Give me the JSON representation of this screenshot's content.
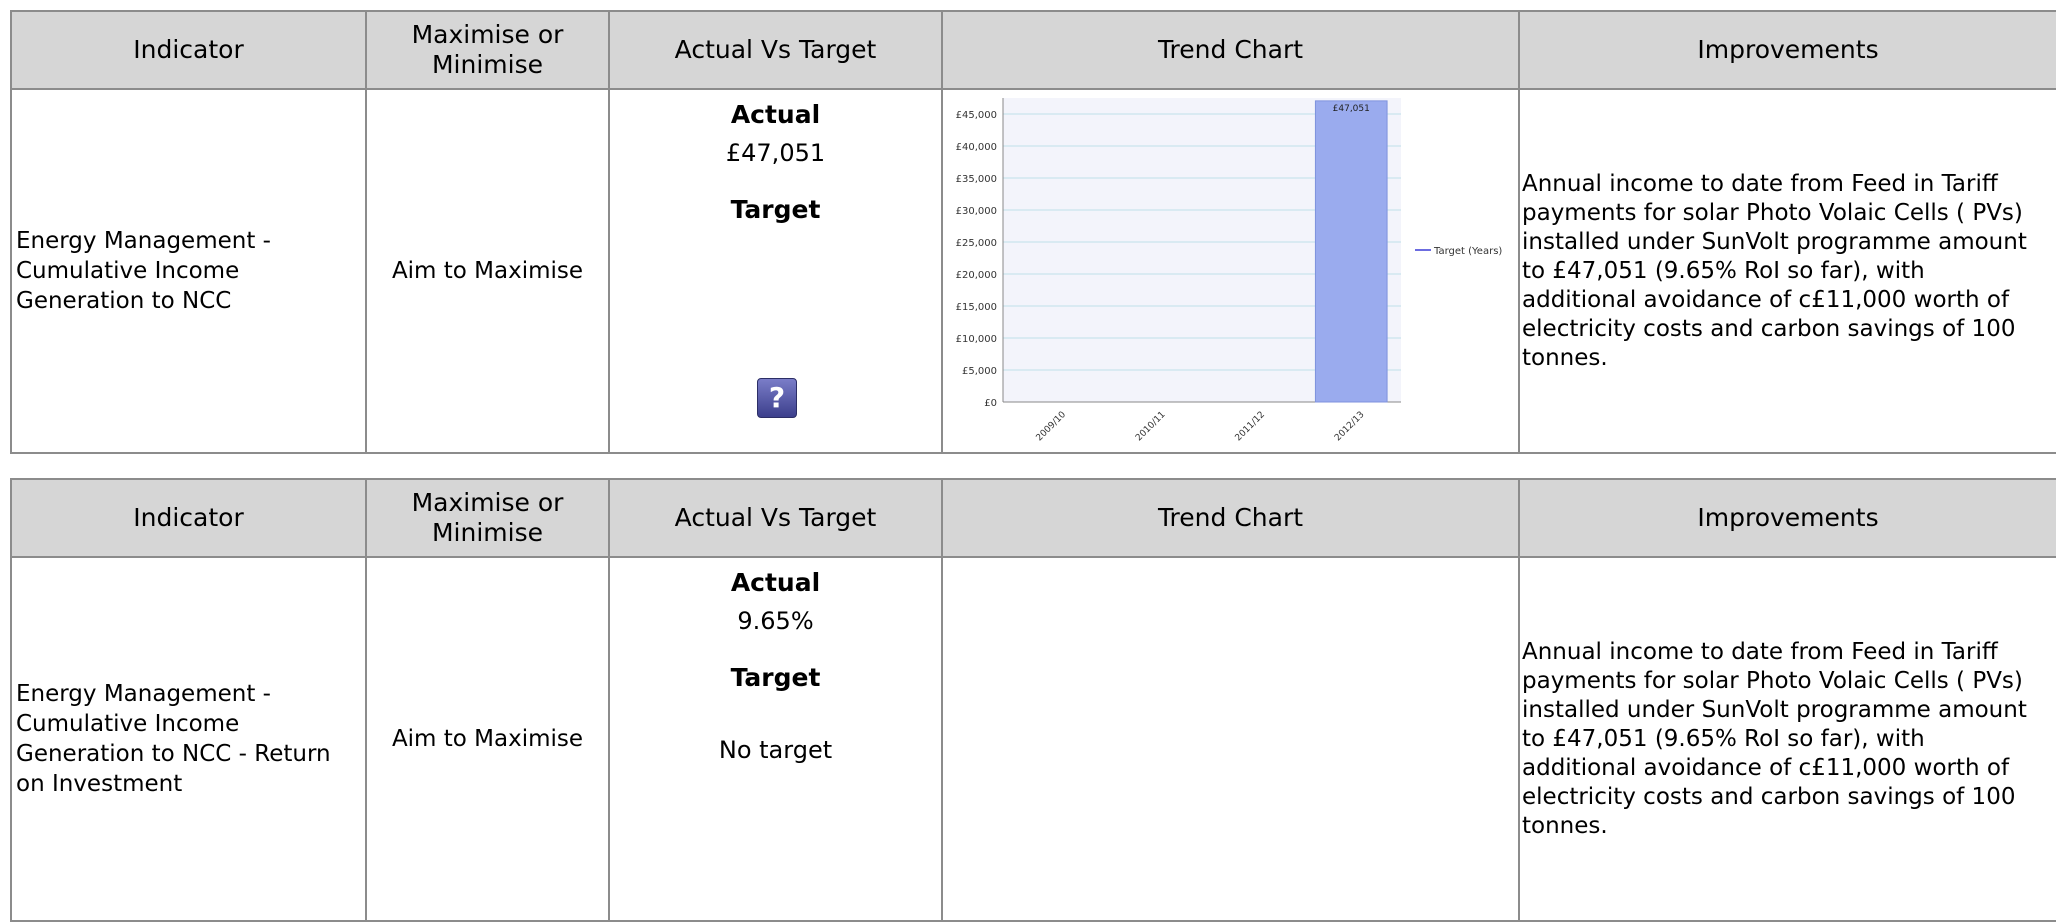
{
  "columns": {
    "indicator": "Indicator",
    "maxmin_line1": "Maximise or",
    "maxmin_line2": "Minimise",
    "actual_vs_target": "Actual Vs Target",
    "trend_chart": "Trend Chart",
    "improvements": "Improvements"
  },
  "rows": [
    {
      "indicator_lines": [
        "Energy Management -",
        "Cumulative Income",
        "Generation to NCC"
      ],
      "maxmin": "Aim to Maximise",
      "actual_label": "Actual",
      "actual_value": "£47,051",
      "target_label": "Target",
      "target_value": "",
      "has_help_icon": true,
      "help_icon": "question-mark-icon",
      "improvement_lines": [
        "Annual income to date from Feed in Tariff",
        "payments for solar Photo Volaic Cells ( PVs)",
        "installed under SunVolt programme amount",
        "to £47,051 (9.65% RoI so far), with",
        "additional avoidance of c£11,000 worth of",
        "electricity costs and carbon savings of 100",
        "tonnes."
      ]
    },
    {
      "indicator_lines": [
        "Energy Management -",
        "Cumulative Income",
        "Generation to NCC - Return",
        "on Investment"
      ],
      "maxmin": "Aim to Maximise",
      "actual_label": "Actual",
      "actual_value": "9.65%",
      "target_label": "Target",
      "target_value": "No target",
      "has_help_icon": false,
      "improvement_lines": [
        "Annual income to date from Feed in Tariff",
        "payments for solar Photo Volaic Cells ( PVs)",
        "installed under SunVolt programme amount",
        "to £47,051 (9.65% RoI so far), with",
        "additional avoidance of c£11,000 worth of",
        "electricity costs and carbon savings of 100",
        "tonnes."
      ]
    }
  ],
  "chart_data": {
    "type": "bar",
    "categories": [
      "2009/10",
      "2010/11",
      "2011/12",
      "2012/13"
    ],
    "values": [
      0,
      0,
      0,
      47051
    ],
    "data_labels": [
      "",
      "",
      "",
      "£47,051"
    ],
    "y_ticks": [
      "£0",
      "£5,000",
      "£10,000",
      "£15,000",
      "£20,000",
      "£25,000",
      "£30,000",
      "£35,000",
      "£40,000",
      "£45,000"
    ],
    "ylim": [
      0,
      47500
    ],
    "legend": [
      "Target (Years)"
    ],
    "legend_position": "right",
    "grid": true,
    "colors": {
      "bar": "#9aabee",
      "bar_border": "#7f92dd",
      "gridline": "#bfe0ea",
      "legend_line": "#3b3bd6",
      "plot_band": "#f3f4fb"
    }
  }
}
